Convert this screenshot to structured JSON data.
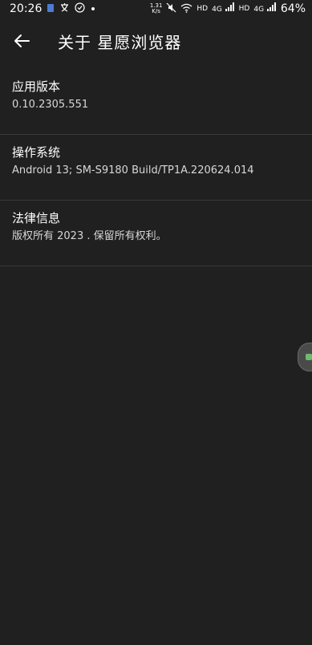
{
  "status_bar": {
    "time": "20:26",
    "speed_value": "1.31",
    "speed_unit": "K/s",
    "hd1": "HD",
    "lte1": "4G",
    "hd2": "HD",
    "lte2": "4G",
    "battery": "64%"
  },
  "header": {
    "back_icon": "arrow-left-icon",
    "title": "关于 星愿浏览器"
  },
  "items": [
    {
      "title": "应用版本",
      "value": "0.10.2305.551"
    },
    {
      "title": "操作系统",
      "value": "Android 13; SM-S9180 Build/TP1A.220624.014"
    },
    {
      "title": "法律信息",
      "value": "版权所有 2023 . 保留所有权利。"
    }
  ]
}
